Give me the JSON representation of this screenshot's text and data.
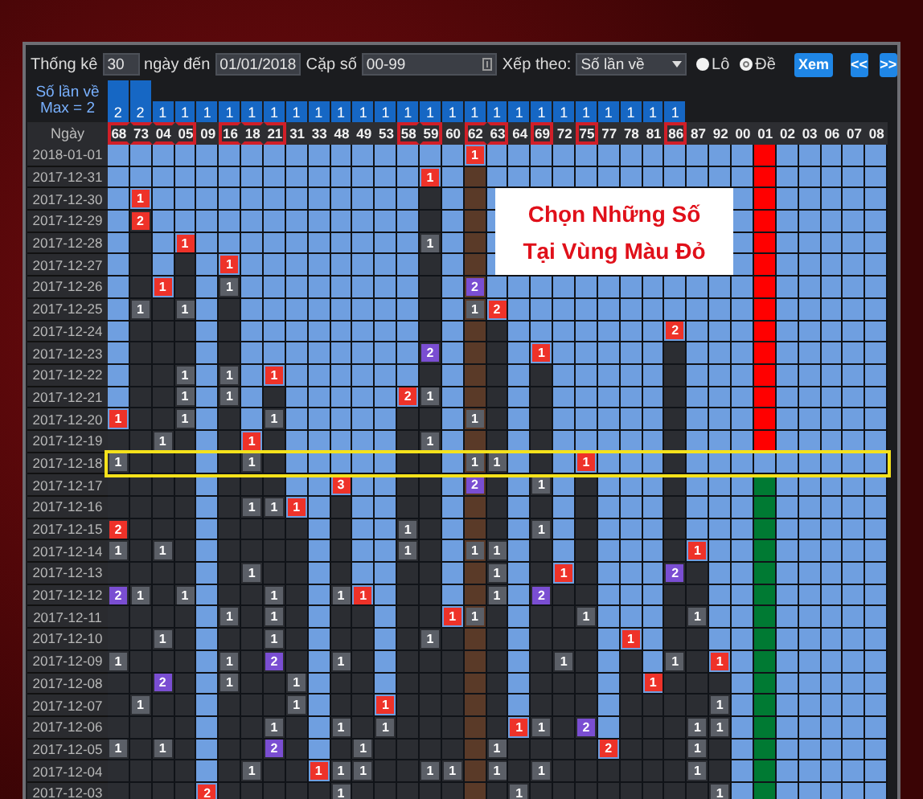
{
  "toolbar": {
    "period_label": "Thống kê",
    "period": "30",
    "date_label": "ngày đến",
    "date": "01/01/2018",
    "pair_label": "Cặp số",
    "pair": "00-99",
    "sort_label": "Xếp theo:",
    "sort": "Số lần về",
    "modes": [
      {
        "label": "Lô",
        "selected": false
      },
      {
        "label": "Đề",
        "selected": true
      }
    ],
    "view_button": "Xem",
    "prev_button": "<<",
    "next_button": ">>"
  },
  "header": {
    "count_label": "Số lần về",
    "max_label": "Max = 2",
    "date_label": "Ngày"
  },
  "columns": [
    {
      "number": "68",
      "count": "2",
      "tall": true,
      "boxed": true,
      "kind": "normal"
    },
    {
      "number": "73",
      "count": "2",
      "tall": true,
      "boxed": true,
      "kind": "normal"
    },
    {
      "number": "04",
      "count": "1",
      "tall": false,
      "boxed": true,
      "kind": "normal"
    },
    {
      "number": "05",
      "count": "1",
      "tall": false,
      "boxed": true,
      "kind": "normal"
    },
    {
      "number": "09",
      "count": "1",
      "tall": false,
      "boxed": false,
      "kind": "normal"
    },
    {
      "number": "16",
      "count": "1",
      "tall": false,
      "boxed": true,
      "kind": "normal"
    },
    {
      "number": "18",
      "count": "1",
      "tall": false,
      "boxed": true,
      "kind": "normal"
    },
    {
      "number": "21",
      "count": "1",
      "tall": false,
      "boxed": true,
      "kind": "normal"
    },
    {
      "number": "31",
      "count": "1",
      "tall": false,
      "boxed": false,
      "kind": "normal"
    },
    {
      "number": "33",
      "count": "1",
      "tall": false,
      "boxed": false,
      "kind": "normal"
    },
    {
      "number": "48",
      "count": "1",
      "tall": false,
      "boxed": false,
      "kind": "normal"
    },
    {
      "number": "49",
      "count": "1",
      "tall": false,
      "boxed": false,
      "kind": "normal"
    },
    {
      "number": "53",
      "count": "1",
      "tall": false,
      "boxed": false,
      "kind": "normal"
    },
    {
      "number": "58",
      "count": "1",
      "tall": false,
      "boxed": true,
      "kind": "normal"
    },
    {
      "number": "59",
      "count": "1",
      "tall": false,
      "boxed": true,
      "kind": "normal"
    },
    {
      "number": "60",
      "count": "1",
      "tall": false,
      "boxed": false,
      "kind": "normal"
    },
    {
      "number": "62",
      "count": "1",
      "tall": false,
      "boxed": true,
      "kind": "brown"
    },
    {
      "number": "63",
      "count": "1",
      "tall": false,
      "boxed": true,
      "kind": "normal"
    },
    {
      "number": "64",
      "count": "1",
      "tall": false,
      "boxed": false,
      "kind": "normal"
    },
    {
      "number": "69",
      "count": "1",
      "tall": false,
      "boxed": true,
      "kind": "normal"
    },
    {
      "number": "72",
      "count": "1",
      "tall": false,
      "boxed": false,
      "kind": "normal"
    },
    {
      "number": "75",
      "count": "1",
      "tall": false,
      "boxed": true,
      "kind": "normal"
    },
    {
      "number": "77",
      "count": "1",
      "tall": false,
      "boxed": false,
      "kind": "normal"
    },
    {
      "number": "78",
      "count": "1",
      "tall": false,
      "boxed": false,
      "kind": "normal"
    },
    {
      "number": "81",
      "count": "1",
      "tall": false,
      "boxed": false,
      "kind": "normal"
    },
    {
      "number": "86",
      "count": "1",
      "tall": false,
      "boxed": true,
      "kind": "normal"
    },
    {
      "number": "87",
      "boxed": false,
      "kind": "normal"
    },
    {
      "number": "92",
      "boxed": false,
      "kind": "normal"
    },
    {
      "number": "00",
      "boxed": false,
      "kind": "normal"
    },
    {
      "number": "01",
      "boxed": false,
      "kind": "hot"
    },
    {
      "number": "02",
      "boxed": false,
      "kind": "normal"
    },
    {
      "number": "03",
      "boxed": false,
      "kind": "normal"
    },
    {
      "number": "06",
      "boxed": false,
      "kind": "normal"
    },
    {
      "number": "07",
      "boxed": false,
      "kind": "normal"
    },
    {
      "number": "08",
      "boxed": false,
      "kind": "normal"
    }
  ],
  "rows": [
    {
      "date": "2018-01-01",
      "highlighted": false,
      "cells": [
        null,
        null,
        null,
        null,
        null,
        null,
        null,
        null,
        null,
        null,
        null,
        null,
        null,
        null,
        null,
        null,
        {
          "text": "1",
          "kind": "red"
        },
        null,
        null,
        null,
        null,
        null,
        null,
        null,
        null,
        null,
        null,
        null,
        null,
        null,
        null,
        null,
        null,
        null,
        null
      ]
    },
    {
      "date": "2017-12-31",
      "highlighted": false,
      "cells": [
        null,
        null,
        null,
        null,
        null,
        null,
        null,
        null,
        null,
        null,
        null,
        null,
        null,
        null,
        {
          "text": "1",
          "kind": "red"
        },
        null,
        null,
        null,
        null,
        null,
        null,
        null,
        null,
        null,
        null,
        null,
        null,
        null,
        null,
        null,
        null,
        null,
        null,
        null,
        null
      ]
    },
    {
      "date": "2017-12-30",
      "highlighted": false,
      "cells": [
        null,
        {
          "text": "1",
          "kind": "red"
        },
        null,
        null,
        null,
        null,
        null,
        null,
        null,
        null,
        null,
        null,
        null,
        null,
        null,
        null,
        null,
        null,
        null,
        null,
        null,
        null,
        null,
        null,
        null,
        null,
        null,
        null,
        null,
        null,
        null,
        null,
        null,
        null,
        null
      ]
    },
    {
      "date": "2017-12-29",
      "highlighted": false,
      "cells": [
        null,
        {
          "text": "2",
          "kind": "red"
        },
        null,
        null,
        null,
        null,
        null,
        null,
        null,
        null,
        null,
        null,
        null,
        null,
        null,
        null,
        null,
        null,
        null,
        null,
        null,
        null,
        null,
        null,
        null,
        null,
        null,
        null,
        null,
        null,
        null,
        null,
        null,
        null,
        null
      ]
    },
    {
      "date": "2017-12-28",
      "highlighted": false,
      "cells": [
        null,
        null,
        null,
        {
          "text": "1",
          "kind": "red"
        },
        null,
        null,
        null,
        null,
        null,
        null,
        null,
        null,
        null,
        null,
        {
          "text": "1",
          "kind": "grey"
        },
        null,
        null,
        null,
        null,
        null,
        null,
        null,
        null,
        null,
        null,
        null,
        null,
        null,
        null,
        null,
        null,
        null,
        null,
        null,
        null
      ]
    },
    {
      "date": "2017-12-27",
      "highlighted": false,
      "cells": [
        null,
        null,
        null,
        null,
        null,
        {
          "text": "1",
          "kind": "red"
        },
        null,
        null,
        null,
        null,
        null,
        null,
        null,
        null,
        null,
        null,
        null,
        null,
        null,
        null,
        null,
        null,
        null,
        null,
        null,
        null,
        null,
        null,
        null,
        null,
        null,
        null,
        null,
        null,
        null
      ]
    },
    {
      "date": "2017-12-26",
      "highlighted": false,
      "cells": [
        null,
        null,
        {
          "text": "1",
          "kind": "red"
        },
        null,
        null,
        {
          "text": "1",
          "kind": "grey"
        },
        null,
        null,
        null,
        null,
        null,
        null,
        null,
        null,
        null,
        null,
        {
          "text": "2",
          "kind": "purple"
        },
        null,
        null,
        null,
        null,
        null,
        null,
        null,
        null,
        null,
        null,
        null,
        null,
        null,
        null,
        null,
        null,
        null,
        null
      ]
    },
    {
      "date": "2017-12-25",
      "highlighted": false,
      "cells": [
        null,
        {
          "text": "1",
          "kind": "grey"
        },
        null,
        {
          "text": "1",
          "kind": "grey"
        },
        null,
        null,
        null,
        null,
        null,
        null,
        null,
        null,
        null,
        null,
        null,
        null,
        {
          "text": "1",
          "kind": "grey"
        },
        {
          "text": "2",
          "kind": "red"
        },
        null,
        null,
        null,
        null,
        null,
        null,
        null,
        null,
        null,
        null,
        null,
        null,
        null,
        null,
        null,
        null,
        null
      ]
    },
    {
      "date": "2017-12-24",
      "highlighted": false,
      "cells": [
        null,
        null,
        null,
        null,
        null,
        null,
        null,
        null,
        null,
        null,
        null,
        null,
        null,
        null,
        null,
        null,
        null,
        null,
        null,
        null,
        null,
        null,
        null,
        null,
        null,
        {
          "text": "2",
          "kind": "red"
        },
        null,
        null,
        null,
        null,
        null,
        null,
        null,
        null,
        null
      ]
    },
    {
      "date": "2017-12-23",
      "highlighted": false,
      "cells": [
        null,
        null,
        null,
        null,
        null,
        null,
        null,
        null,
        null,
        null,
        null,
        null,
        null,
        null,
        {
          "text": "2",
          "kind": "purple"
        },
        null,
        null,
        null,
        null,
        {
          "text": "1",
          "kind": "red"
        },
        null,
        null,
        null,
        null,
        null,
        null,
        null,
        null,
        null,
        null,
        null,
        null,
        null,
        null,
        null
      ]
    },
    {
      "date": "2017-12-22",
      "highlighted": false,
      "cells": [
        null,
        null,
        null,
        {
          "text": "1",
          "kind": "grey"
        },
        null,
        {
          "text": "1",
          "kind": "grey"
        },
        null,
        {
          "text": "1",
          "kind": "red"
        },
        null,
        null,
        null,
        null,
        null,
        null,
        null,
        null,
        null,
        null,
        null,
        null,
        null,
        null,
        null,
        null,
        null,
        null,
        null,
        null,
        null,
        null,
        null,
        null,
        null,
        null,
        null
      ]
    },
    {
      "date": "2017-12-21",
      "highlighted": false,
      "cells": [
        null,
        null,
        null,
        {
          "text": "1",
          "kind": "grey"
        },
        null,
        {
          "text": "1",
          "kind": "grey"
        },
        null,
        null,
        null,
        null,
        null,
        null,
        null,
        {
          "text": "2",
          "kind": "red"
        },
        {
          "text": "1",
          "kind": "grey"
        },
        null,
        null,
        null,
        null,
        null,
        null,
        null,
        null,
        null,
        null,
        null,
        null,
        null,
        null,
        null,
        null,
        null,
        null,
        null,
        null
      ]
    },
    {
      "date": "2017-12-20",
      "highlighted": false,
      "cells": [
        {
          "text": "1",
          "kind": "red"
        },
        null,
        null,
        {
          "text": "1",
          "kind": "grey"
        },
        null,
        null,
        null,
        {
          "text": "1",
          "kind": "grey"
        },
        null,
        null,
        null,
        null,
        null,
        null,
        null,
        null,
        {
          "text": "1",
          "kind": "grey"
        },
        null,
        null,
        null,
        null,
        null,
        null,
        null,
        null,
        null,
        null,
        null,
        null,
        null,
        null,
        null,
        null,
        null,
        null
      ]
    },
    {
      "date": "2017-12-19",
      "highlighted": false,
      "cells": [
        null,
        null,
        {
          "text": "1",
          "kind": "grey"
        },
        null,
        null,
        null,
        {
          "text": "1",
          "kind": "red"
        },
        null,
        null,
        null,
        null,
        null,
        null,
        null,
        {
          "text": "1",
          "kind": "grey"
        },
        null,
        null,
        null,
        null,
        null,
        null,
        null,
        null,
        null,
        null,
        null,
        null,
        null,
        null,
        null,
        null,
        null,
        null,
        null,
        null
      ]
    },
    {
      "date": "2017-12-18",
      "highlighted": true,
      "cells": [
        {
          "text": "1",
          "kind": "grey"
        },
        null,
        null,
        null,
        null,
        null,
        {
          "text": "1",
          "kind": "grey"
        },
        null,
        null,
        null,
        null,
        null,
        null,
        null,
        null,
        null,
        {
          "text": "1",
          "kind": "grey"
        },
        {
          "text": "1",
          "kind": "grey"
        },
        null,
        null,
        null,
        {
          "text": "1",
          "kind": "red"
        },
        null,
        null,
        null,
        null,
        null,
        null,
        null,
        null,
        null,
        null,
        null,
        null,
        null
      ]
    },
    {
      "date": "2017-12-17",
      "highlighted": false,
      "cells": [
        null,
        null,
        null,
        null,
        null,
        null,
        null,
        null,
        null,
        null,
        {
          "text": "3",
          "kind": "red"
        },
        null,
        null,
        null,
        null,
        null,
        {
          "text": "2",
          "kind": "purple"
        },
        null,
        null,
        {
          "text": "1",
          "kind": "grey"
        },
        null,
        null,
        null,
        null,
        null,
        null,
        null,
        null,
        null,
        null,
        null,
        null,
        null,
        null,
        null
      ]
    },
    {
      "date": "2017-12-16",
      "highlighted": false,
      "cells": [
        null,
        null,
        null,
        null,
        null,
        null,
        {
          "text": "1",
          "kind": "grey"
        },
        {
          "text": "1",
          "kind": "grey"
        },
        {
          "text": "1",
          "kind": "red"
        },
        null,
        null,
        null,
        null,
        null,
        null,
        null,
        null,
        null,
        null,
        null,
        null,
        null,
        null,
        null,
        null,
        null,
        null,
        null,
        null,
        null,
        null,
        null,
        null,
        null,
        null
      ]
    },
    {
      "date": "2017-12-15",
      "highlighted": false,
      "cells": [
        {
          "text": "2",
          "kind": "red"
        },
        null,
        null,
        null,
        null,
        null,
        null,
        null,
        null,
        null,
        null,
        null,
        null,
        {
          "text": "1",
          "kind": "grey"
        },
        null,
        null,
        null,
        null,
        null,
        {
          "text": "1",
          "kind": "grey"
        },
        null,
        null,
        null,
        null,
        null,
        null,
        null,
        null,
        null,
        null,
        null,
        null,
        null,
        null,
        null
      ]
    },
    {
      "date": "2017-12-14",
      "highlighted": false,
      "cells": [
        {
          "text": "1",
          "kind": "grey"
        },
        null,
        {
          "text": "1",
          "kind": "grey"
        },
        null,
        null,
        null,
        null,
        null,
        null,
        null,
        null,
        null,
        null,
        {
          "text": "1",
          "kind": "grey"
        },
        null,
        null,
        {
          "text": "1",
          "kind": "grey"
        },
        {
          "text": "1",
          "kind": "grey"
        },
        null,
        null,
        null,
        null,
        null,
        null,
        null,
        null,
        {
          "text": "1",
          "kind": "red"
        },
        null,
        null,
        null,
        null,
        null,
        null,
        null,
        null
      ]
    },
    {
      "date": "2017-12-13",
      "highlighted": false,
      "cells": [
        null,
        null,
        null,
        null,
        null,
        null,
        {
          "text": "1",
          "kind": "grey"
        },
        null,
        null,
        null,
        null,
        null,
        null,
        null,
        null,
        null,
        null,
        {
          "text": "1",
          "kind": "grey"
        },
        null,
        null,
        {
          "text": "1",
          "kind": "red"
        },
        null,
        null,
        null,
        null,
        {
          "text": "2",
          "kind": "purple"
        },
        null,
        null,
        null,
        null,
        null,
        null,
        null,
        null,
        null
      ]
    },
    {
      "date": "2017-12-12",
      "highlighted": false,
      "cells": [
        {
          "text": "2",
          "kind": "purple"
        },
        {
          "text": "1",
          "kind": "grey"
        },
        null,
        {
          "text": "1",
          "kind": "grey"
        },
        null,
        null,
        null,
        {
          "text": "1",
          "kind": "grey"
        },
        null,
        null,
        {
          "text": "1",
          "kind": "grey"
        },
        {
          "text": "1",
          "kind": "red"
        },
        null,
        null,
        null,
        null,
        null,
        {
          "text": "1",
          "kind": "grey"
        },
        null,
        {
          "text": "2",
          "kind": "purple"
        },
        null,
        null,
        null,
        null,
        null,
        null,
        null,
        null,
        null,
        null,
        null,
        null,
        null,
        null,
        null
      ]
    },
    {
      "date": "2017-12-11",
      "highlighted": false,
      "cells": [
        null,
        null,
        null,
        null,
        null,
        {
          "text": "1",
          "kind": "grey"
        },
        null,
        {
          "text": "1",
          "kind": "grey"
        },
        null,
        null,
        null,
        null,
        null,
        null,
        null,
        {
          "text": "1",
          "kind": "red"
        },
        {
          "text": "1",
          "kind": "grey"
        },
        null,
        null,
        null,
        null,
        {
          "text": "1",
          "kind": "grey"
        },
        null,
        null,
        null,
        null,
        {
          "text": "1",
          "kind": "grey"
        },
        null,
        null,
        null,
        null,
        null,
        null,
        null,
        null
      ]
    },
    {
      "date": "2017-12-10",
      "highlighted": false,
      "cells": [
        null,
        null,
        {
          "text": "1",
          "kind": "grey"
        },
        null,
        null,
        null,
        null,
        {
          "text": "1",
          "kind": "grey"
        },
        null,
        null,
        null,
        null,
        null,
        null,
        {
          "text": "1",
          "kind": "grey"
        },
        null,
        null,
        null,
        null,
        null,
        null,
        null,
        null,
        {
          "text": "1",
          "kind": "red"
        },
        null,
        null,
        null,
        null,
        null,
        null,
        null,
        null,
        null,
        null,
        null
      ]
    },
    {
      "date": "2017-12-09",
      "highlighted": false,
      "cells": [
        {
          "text": "1",
          "kind": "grey"
        },
        null,
        null,
        null,
        null,
        {
          "text": "1",
          "kind": "grey"
        },
        null,
        {
          "text": "2",
          "kind": "purple"
        },
        null,
        null,
        {
          "text": "1",
          "kind": "grey"
        },
        null,
        null,
        null,
        null,
        null,
        null,
        null,
        null,
        null,
        {
          "text": "1",
          "kind": "grey"
        },
        null,
        null,
        null,
        null,
        {
          "text": "1",
          "kind": "grey"
        },
        null,
        {
          "text": "1",
          "kind": "red"
        },
        null,
        null,
        null,
        null,
        null,
        null,
        null
      ]
    },
    {
      "date": "2017-12-08",
      "highlighted": false,
      "cells": [
        null,
        null,
        {
          "text": "2",
          "kind": "purple"
        },
        null,
        null,
        {
          "text": "1",
          "kind": "grey"
        },
        null,
        null,
        {
          "text": "1",
          "kind": "grey"
        },
        null,
        null,
        null,
        null,
        null,
        null,
        null,
        null,
        null,
        null,
        null,
        null,
        null,
        null,
        null,
        {
          "text": "1",
          "kind": "red"
        },
        null,
        null,
        null,
        null,
        null,
        null,
        null,
        null,
        null,
        null
      ]
    },
    {
      "date": "2017-12-07",
      "highlighted": false,
      "cells": [
        null,
        {
          "text": "1",
          "kind": "grey"
        },
        null,
        null,
        null,
        null,
        null,
        null,
        {
          "text": "1",
          "kind": "grey"
        },
        null,
        null,
        null,
        {
          "text": "1",
          "kind": "red"
        },
        null,
        null,
        null,
        null,
        null,
        null,
        null,
        null,
        null,
        null,
        null,
        null,
        null,
        null,
        {
          "text": "1",
          "kind": "grey"
        },
        null,
        null,
        null,
        null,
        null,
        null,
        null
      ]
    },
    {
      "date": "2017-12-06",
      "highlighted": false,
      "cells": [
        null,
        null,
        null,
        null,
        null,
        null,
        null,
        {
          "text": "1",
          "kind": "grey"
        },
        null,
        null,
        {
          "text": "1",
          "kind": "grey"
        },
        null,
        {
          "text": "1",
          "kind": "grey"
        },
        null,
        null,
        null,
        null,
        null,
        {
          "text": "1",
          "kind": "red"
        },
        {
          "text": "1",
          "kind": "grey"
        },
        null,
        {
          "text": "2",
          "kind": "purple"
        },
        null,
        null,
        null,
        null,
        {
          "text": "1",
          "kind": "grey"
        },
        {
          "text": "1",
          "kind": "grey"
        },
        null,
        null,
        null,
        null,
        null,
        null,
        null
      ]
    },
    {
      "date": "2017-12-05",
      "highlighted": false,
      "cells": [
        {
          "text": "1",
          "kind": "grey"
        },
        null,
        {
          "text": "1",
          "kind": "grey"
        },
        null,
        null,
        null,
        null,
        {
          "text": "2",
          "kind": "purple"
        },
        null,
        null,
        null,
        {
          "text": "1",
          "kind": "grey"
        },
        null,
        null,
        null,
        null,
        null,
        {
          "text": "1",
          "kind": "grey"
        },
        null,
        null,
        null,
        null,
        {
          "text": "2",
          "kind": "red"
        },
        null,
        null,
        null,
        {
          "text": "1",
          "kind": "grey"
        },
        null,
        null,
        null,
        null,
        null,
        null,
        null,
        null
      ]
    },
    {
      "date": "2017-12-04",
      "highlighted": false,
      "cells": [
        null,
        null,
        null,
        null,
        null,
        null,
        {
          "text": "1",
          "kind": "grey"
        },
        null,
        null,
        {
          "text": "1",
          "kind": "red"
        },
        {
          "text": "1",
          "kind": "grey"
        },
        {
          "text": "1",
          "kind": "grey"
        },
        null,
        null,
        {
          "text": "1",
          "kind": "grey"
        },
        {
          "text": "1",
          "kind": "grey"
        },
        null,
        {
          "text": "1",
          "kind": "grey"
        },
        null,
        {
          "text": "1",
          "kind": "grey"
        },
        null,
        null,
        null,
        null,
        null,
        null,
        {
          "text": "1",
          "kind": "grey"
        },
        null,
        null,
        null,
        null,
        null,
        null,
        null,
        null
      ]
    },
    {
      "date": "2017-12-03",
      "highlighted": false,
      "cells": [
        null,
        null,
        null,
        null,
        {
          "text": "2",
          "kind": "red"
        },
        null,
        null,
        null,
        null,
        null,
        {
          "text": "1",
          "kind": "grey"
        },
        null,
        null,
        null,
        null,
        null,
        null,
        null,
        {
          "text": "1",
          "kind": "grey"
        },
        null,
        null,
        null,
        null,
        null,
        null,
        null,
        null,
        {
          "text": "1",
          "kind": "grey"
        },
        null,
        null,
        null,
        null,
        null,
        null,
        null
      ]
    }
  ],
  "note": {
    "lines": [
      "Chọn Những Số",
      "Tại Vùng Màu Đỏ"
    ]
  }
}
